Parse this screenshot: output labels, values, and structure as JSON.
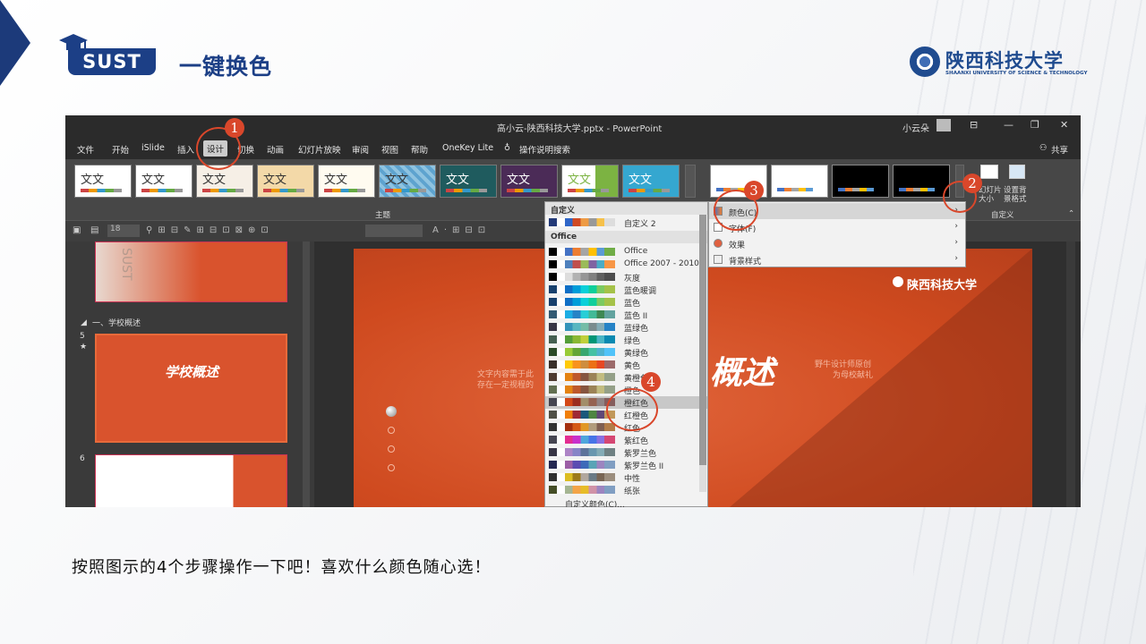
{
  "header": {
    "logo_text": "SUST",
    "title": "一键换色",
    "university_name": "陕西科技大学",
    "university_en": "SHAANXI UNIVERSITY OF SCIENCE & TECHNOLOGY"
  },
  "screenshot": {
    "window_title": "高小云-陕西科技大学.pptx - PowerPoint",
    "user_name": "小云朵",
    "menu": [
      "文件",
      "开始",
      "iSlide",
      "插入",
      "设计",
      "切换",
      "动画",
      "幻灯片放映",
      "审阅",
      "视图",
      "帮助",
      "OneKey Lite",
      "操作说明搜索"
    ],
    "selected_tab": "设计",
    "share_label": "共享",
    "theme_label": "主题",
    "theme_sample_text": "文文",
    "customize_label": "自定义",
    "slide_size_label": "幻灯片大小",
    "bg_format_label": "设置背景格式",
    "font_size_value": "18",
    "section_label": "一、学校概述",
    "slide_numbers": [
      "5",
      "6"
    ],
    "slide_star": "★",
    "thumb_title_5": "学校概述",
    "main_slide_text": "概述",
    "main_slide_caption_1": "文字内容需于此",
    "main_slide_caption_2": "存在一定视程的",
    "main_slide_right_1": "野牛设计师原创",
    "main_slide_right_2": "为母校献礼",
    "main_slide_logo": "陕西科技大学",
    "dropdown": {
      "custom_header": "自定义",
      "custom_item": "自定义 2",
      "office_header": "Office",
      "items": [
        "Office",
        "Office 2007 - 2010",
        "灰度",
        "蓝色暖调",
        "蓝色",
        "蓝色 II",
        "蓝绿色",
        "绿色",
        "黄绿色",
        "黄色",
        "黄橙色",
        "橙色",
        "橙红色",
        "红橙色",
        "红色",
        "紫红色",
        "紫罗兰色",
        "紫罗兰色 II",
        "中性",
        "纸张"
      ],
      "highlighted": "橙红色",
      "footer": "自定义颜色(C)..."
    },
    "submenu": {
      "items": [
        "颜色(C)",
        "字体(F)",
        "效果",
        "背景样式"
      ],
      "highlighted": "颜色(C)"
    },
    "step_numbers": [
      "1",
      "2",
      "3",
      "4"
    ]
  },
  "instruction": "按照图示的4个步骤操作一下吧！喜欢什么颜色随心选！",
  "colors": {
    "brand_blue": "#1c3f86",
    "callout_red": "#d9472b",
    "slide_orange": "#cf4a1f"
  }
}
